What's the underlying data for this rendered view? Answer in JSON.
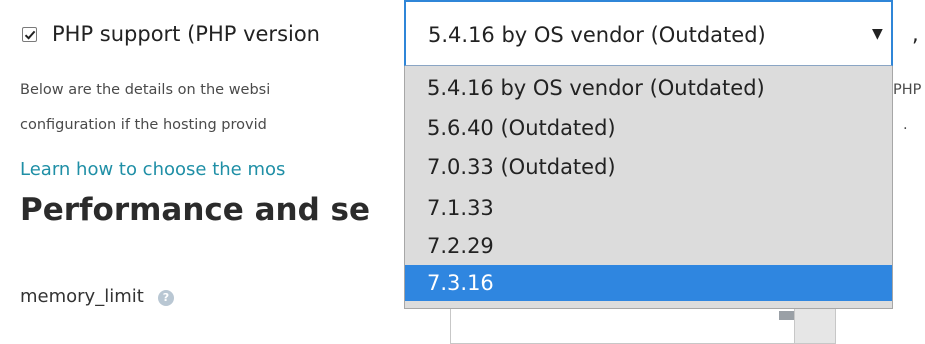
{
  "php_support": {
    "checked": true,
    "label": "PHP support (PHP version",
    "after_select_text": ", ru"
  },
  "php_version_select": {
    "current_value": "5.4.16 by OS vendor (Outdated)",
    "caret": "▼",
    "options": [
      {
        "label": "5.4.16 by OS vendor (Outdated)"
      },
      {
        "label": "5.6.40 (Outdated)"
      },
      {
        "label": "7.0.33 (Outdated)"
      },
      {
        "label": "7.1.33"
      },
      {
        "label": "7.2.29"
      },
      {
        "label": "7.3.16",
        "highlighted": true
      }
    ]
  },
  "description": {
    "line1_left": "Below are the details on the websi",
    "line1_right": "PHP",
    "line2_left": "configuration if the hosting provid",
    "line2_right": "."
  },
  "learn_link": "Learn how to choose the mos",
  "section_title": "Performance and se",
  "memory_limit": {
    "label": "memory_limit",
    "help_icon_glyph": "?"
  },
  "colors": {
    "link": "#1f8fa6",
    "selected_option_bg": "#2f86e0",
    "dropdown_bg": "#dcdcdc",
    "focus_border": "#2f86d8"
  }
}
